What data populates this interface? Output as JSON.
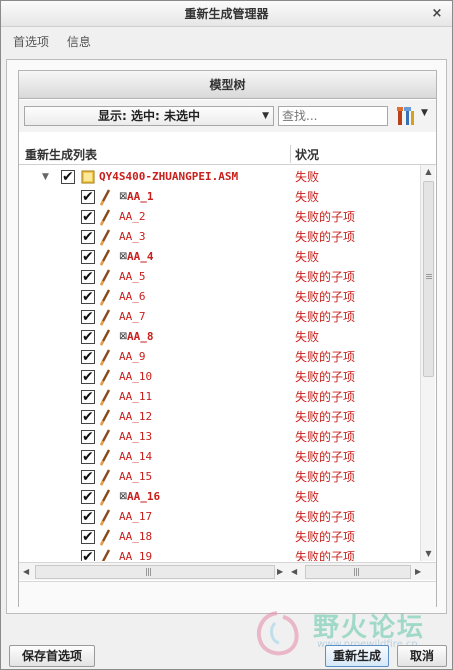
{
  "window": {
    "title": "重新生成管理器",
    "close_symbol": "×"
  },
  "menu": {
    "items": [
      {
        "label": "首选项"
      },
      {
        "label": "信息"
      }
    ]
  },
  "panel": {
    "header": "模型树",
    "display_select": "显示: 选中: 未选中",
    "search_placeholder": "查找...",
    "columns": {
      "list": "重新生成列表",
      "status": "状况"
    }
  },
  "rows": [
    {
      "name": "QY4S400-ZHUANGPEI.ASM",
      "status": "失败",
      "kind": "asm",
      "bold": true
    },
    {
      "name": "AA_1",
      "status": "失败",
      "kind": "feature-failed",
      "bold": true
    },
    {
      "name": "AA_2",
      "status": "失败的子项",
      "kind": "feature",
      "bold": false
    },
    {
      "name": "AA_3",
      "status": "失败的子项",
      "kind": "feature",
      "bold": false
    },
    {
      "name": "AA_4",
      "status": "失败",
      "kind": "feature-failed",
      "bold": true
    },
    {
      "name": "AA_5",
      "status": "失败的子项",
      "kind": "feature",
      "bold": false
    },
    {
      "name": "AA_6",
      "status": "失败的子项",
      "kind": "feature",
      "bold": false
    },
    {
      "name": "AA_7",
      "status": "失败的子项",
      "kind": "feature",
      "bold": false
    },
    {
      "name": "AA_8",
      "status": "失败",
      "kind": "feature-failed",
      "bold": true
    },
    {
      "name": "AA_9",
      "status": "失败的子项",
      "kind": "feature",
      "bold": false
    },
    {
      "name": "AA_10",
      "status": "失败的子项",
      "kind": "feature",
      "bold": false
    },
    {
      "name": "AA_11",
      "status": "失败的子项",
      "kind": "feature",
      "bold": false
    },
    {
      "name": "AA_12",
      "status": "失败的子项",
      "kind": "feature",
      "bold": false
    },
    {
      "name": "AA_13",
      "status": "失败的子项",
      "kind": "feature",
      "bold": false
    },
    {
      "name": "AA_14",
      "status": "失败的子项",
      "kind": "feature",
      "bold": false
    },
    {
      "name": "AA_15",
      "status": "失败的子项",
      "kind": "feature",
      "bold": false
    },
    {
      "name": "AA_16",
      "status": "失败",
      "kind": "feature-failed",
      "bold": true
    },
    {
      "name": "AA_17",
      "status": "失败的子项",
      "kind": "feature",
      "bold": false
    },
    {
      "name": "AA_18",
      "status": "失败的子项",
      "kind": "feature",
      "bold": false
    },
    {
      "name": "AA_19",
      "status": "失败的子项",
      "kind": "feature",
      "bold": false
    }
  ],
  "buttons": {
    "save_prefs": "保存首选项",
    "regenerate": "重新生成",
    "cancel": "取消"
  },
  "watermark": {
    "text": "野火论坛",
    "sub": "www.proewildfire.cn"
  },
  "colors": {
    "failed_text": "#c8201c",
    "accent": "#5b8fc7"
  }
}
